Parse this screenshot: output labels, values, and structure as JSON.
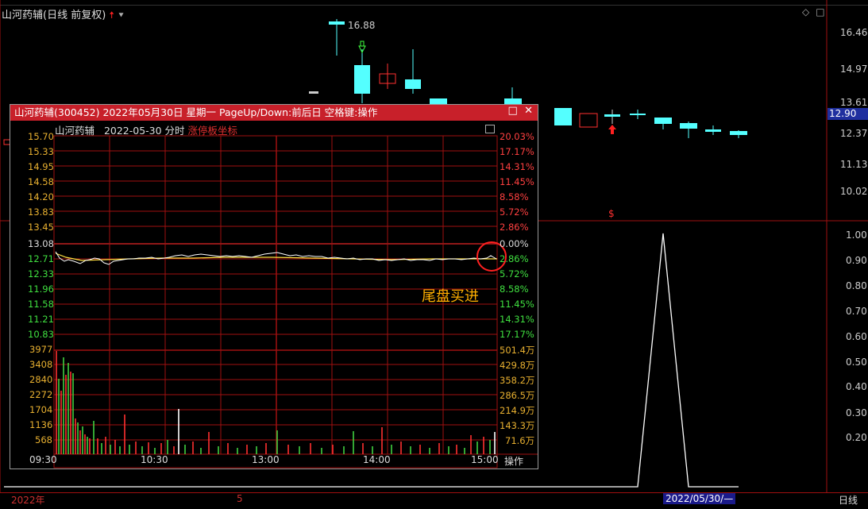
{
  "main": {
    "title": "山河药辅(日线 前复权)",
    "high_label": "16.88",
    "current_price": "12.90",
    "right_price_axis": [
      "16.46",
      "14.97",
      "13.61",
      "12.37",
      "11.13",
      "10.02"
    ],
    "right_indicator_axis": [
      "1.00",
      "0.90",
      "0.80",
      "0.70",
      "0.60",
      "0.50",
      "0.40",
      "0.30",
      "0.20"
    ],
    "marker": "$",
    "date_start": "2022年",
    "date_month": "5",
    "date_cursor": "2022/05/30/—",
    "period": "日线"
  },
  "popup": {
    "title": "山河药辅(300452)  2022年05月30日  星期一  PageUp/Down:前后日  空格键:操作",
    "header_name": "山河药辅",
    "header_date": "2022-05-30 分时",
    "header_mode": "涨停板坐标",
    "price_labels": [
      "15.70",
      "15.33",
      "14.95",
      "14.58",
      "14.20",
      "13.83",
      "13.45",
      "13.08",
      "12.71",
      "12.33",
      "11.96",
      "11.58",
      "11.21",
      "10.83"
    ],
    "pct_labels": [
      "20.03%",
      "17.17%",
      "14.31%",
      "11.45%",
      "8.58%",
      "5.72%",
      "2.86%",
      "0.00%",
      "2.86%",
      "5.72%",
      "8.58%",
      "11.45%",
      "14.31%",
      "17.17%"
    ],
    "vol_left": [
      "3977",
      "3408",
      "2840",
      "2272",
      "1704",
      "1136",
      "568"
    ],
    "vol_right": [
      "501.4万",
      "429.8万",
      "358.2万",
      "286.5万",
      "214.9万",
      "143.3万",
      "71.6万"
    ],
    "time_labels": [
      "09:30",
      "10:30",
      "13:00",
      "14:00",
      "15:00"
    ],
    "op_label": "操作",
    "annotation": "尾盘买进"
  },
  "colors": {
    "up_candle": "#ff3030",
    "down_candle": "#54ffff",
    "grid": "#a01010",
    "title_bar": "#c8202a",
    "avg_line": "#ffe040",
    "price_line": "#ffffff"
  }
}
